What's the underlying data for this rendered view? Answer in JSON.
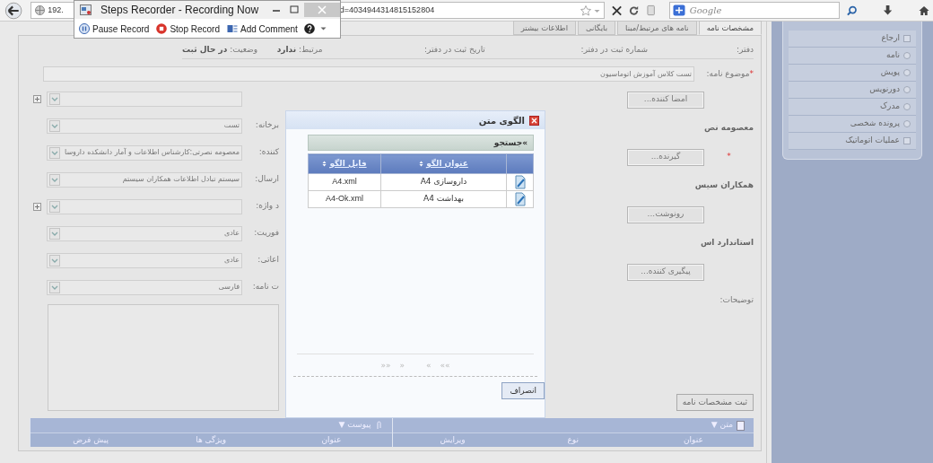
{
  "browser": {
    "url_start": "192.",
    "url_end": "d=4034944314815152804",
    "search_placeholder": "Google"
  },
  "recorder": {
    "title": "Steps Recorder - Recording Now",
    "pause_button": "Pause Record",
    "stop_button": "Stop Record",
    "comment_button": "Add Comment"
  },
  "tabs": [
    {
      "label": "مشخصات نامه",
      "selected": true
    },
    {
      "label": "نامه های مرتبط/مبنا",
      "selected": false
    },
    {
      "label": "بایگانی",
      "selected": false
    },
    {
      "label": "اطلاعات بیشتر",
      "selected": false
    }
  ],
  "info": [
    {
      "label": "دفتر:"
    },
    {
      "label": "شماره ثبت در دفتر:"
    },
    {
      "label": "تاریخ ثبت در دفتر:"
    },
    {
      "label": "مرتبط:",
      "value": "ندارد"
    },
    {
      "label": "وضعیت:",
      "value": "در حال ثبت"
    }
  ],
  "subject": {
    "required_mark": "*",
    "label": "موضوع نامه:",
    "value": "تست کلاس آموزش اتوماسیون"
  },
  "left_fields": [
    {
      "kind": "select",
      "expander": true
    },
    {
      "kind": "select",
      "label": "برخانه:",
      "value": "تست"
    },
    {
      "kind": "select",
      "label": "کننده:",
      "value": "معصومه نصرتی:کارشناس اطلاعات و آمار دانشکده داروسا"
    },
    {
      "kind": "select",
      "label": "ارسال:",
      "value": "سیستم تبادل اطلاعات همکاران سیستم"
    },
    {
      "kind": "select",
      "label": "د واژه:",
      "expander": true
    },
    {
      "kind": "select",
      "label": "فوریت:",
      "value": "عادی"
    },
    {
      "kind": "select",
      "label": "اعاتی:",
      "value": "عادی"
    },
    {
      "kind": "select",
      "label": "ت نامه:",
      "value": "فارسی"
    },
    {
      "kind": "textarea"
    }
  ],
  "right_fields": [
    {
      "kind": "button",
      "label": "امضا کننده..."
    },
    {
      "kind": "heading",
      "label": "معصومه نص"
    },
    {
      "kind": "button",
      "label": "گیرنده...",
      "required_mark": "*"
    },
    {
      "kind": "heading",
      "label": "همکاران سیس"
    },
    {
      "kind": "button",
      "label": "رونوشت..."
    },
    {
      "kind": "heading",
      "label": "استاندارد اس"
    },
    {
      "kind": "button",
      "label": "پیگیری کننده..."
    },
    {
      "kind": "label",
      "label": "توضیحات:"
    }
  ],
  "save_button": "ثبت مشخصات نامه",
  "grids": [
    {
      "title": "متن",
      "caret": "▼",
      "columns": [
        "عنوان",
        "نوع",
        "ویرایش"
      ]
    },
    {
      "title": "پیوست",
      "caret": "▼",
      "columns": [
        "عنوان",
        "ویژگی ها",
        "پیش فرض"
      ]
    }
  ],
  "sidebar": [
    {
      "kind": "check",
      "label": "ارجاع"
    },
    {
      "kind": "radio",
      "label": "نامه"
    },
    {
      "kind": "radio",
      "label": "پویش"
    },
    {
      "kind": "radio",
      "label": "دورنویس"
    },
    {
      "kind": "radio",
      "label": "مدرک"
    },
    {
      "kind": "radio",
      "label": "پرونده شخصی"
    },
    {
      "kind": "check",
      "label": "عملیات اتوماتیک"
    }
  ],
  "dialog": {
    "title": "الگوی متن",
    "search": "»جستجو",
    "columns": [
      "عنوان الگو",
      "فایل الگو"
    ],
    "rows": [
      {
        "title": "داروسازی A4",
        "file": "A4.xml"
      },
      {
        "title": "بهداشت A4",
        "file": "A4-Ok.xml"
      }
    ],
    "pager": [
      "»»",
      "»",
      "«",
      "««"
    ],
    "cancel": "انصراف"
  }
}
